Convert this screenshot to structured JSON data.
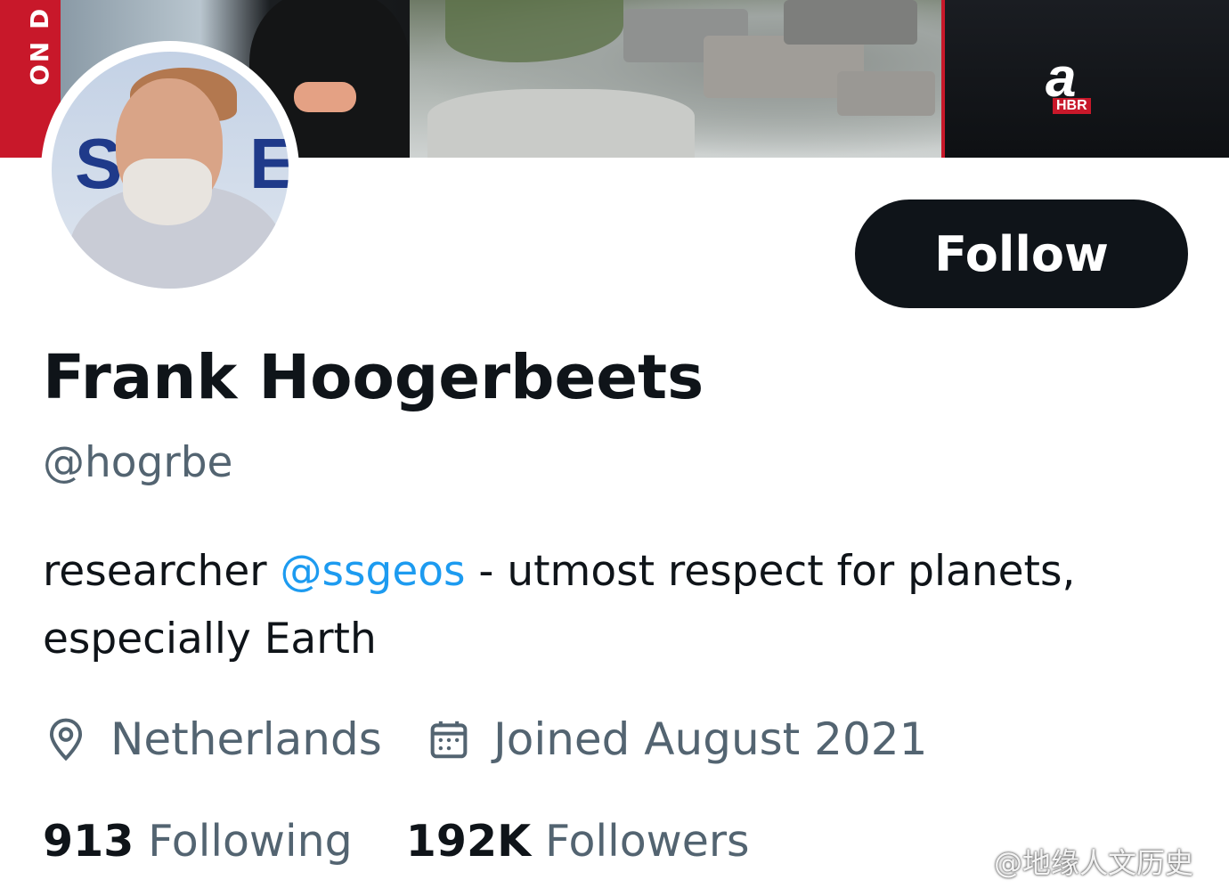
{
  "banner": {
    "side_text": "ON D",
    "logo_letter": "a",
    "logo_sub": "HBR"
  },
  "profile": {
    "follow_label": "Follow",
    "display_name": "Frank Hoogerbeets",
    "handle": "@hogrbe",
    "bio_prefix": "researcher ",
    "bio_mention": "@ssgeos",
    "bio_suffix": " - utmost respect for planets, especially Earth",
    "location": "Netherlands",
    "joined": "Joined August 2021",
    "following_count": "913",
    "following_label": "Following",
    "followers_count": "192K",
    "followers_label": "Followers"
  },
  "watermark": {
    "text": "@地缘人文历史",
    "icon": "weibo-icon"
  },
  "colors": {
    "text_primary": "#0f1419",
    "text_secondary": "#536471",
    "link": "#1d9bf0",
    "button_bg": "#0f1419"
  }
}
